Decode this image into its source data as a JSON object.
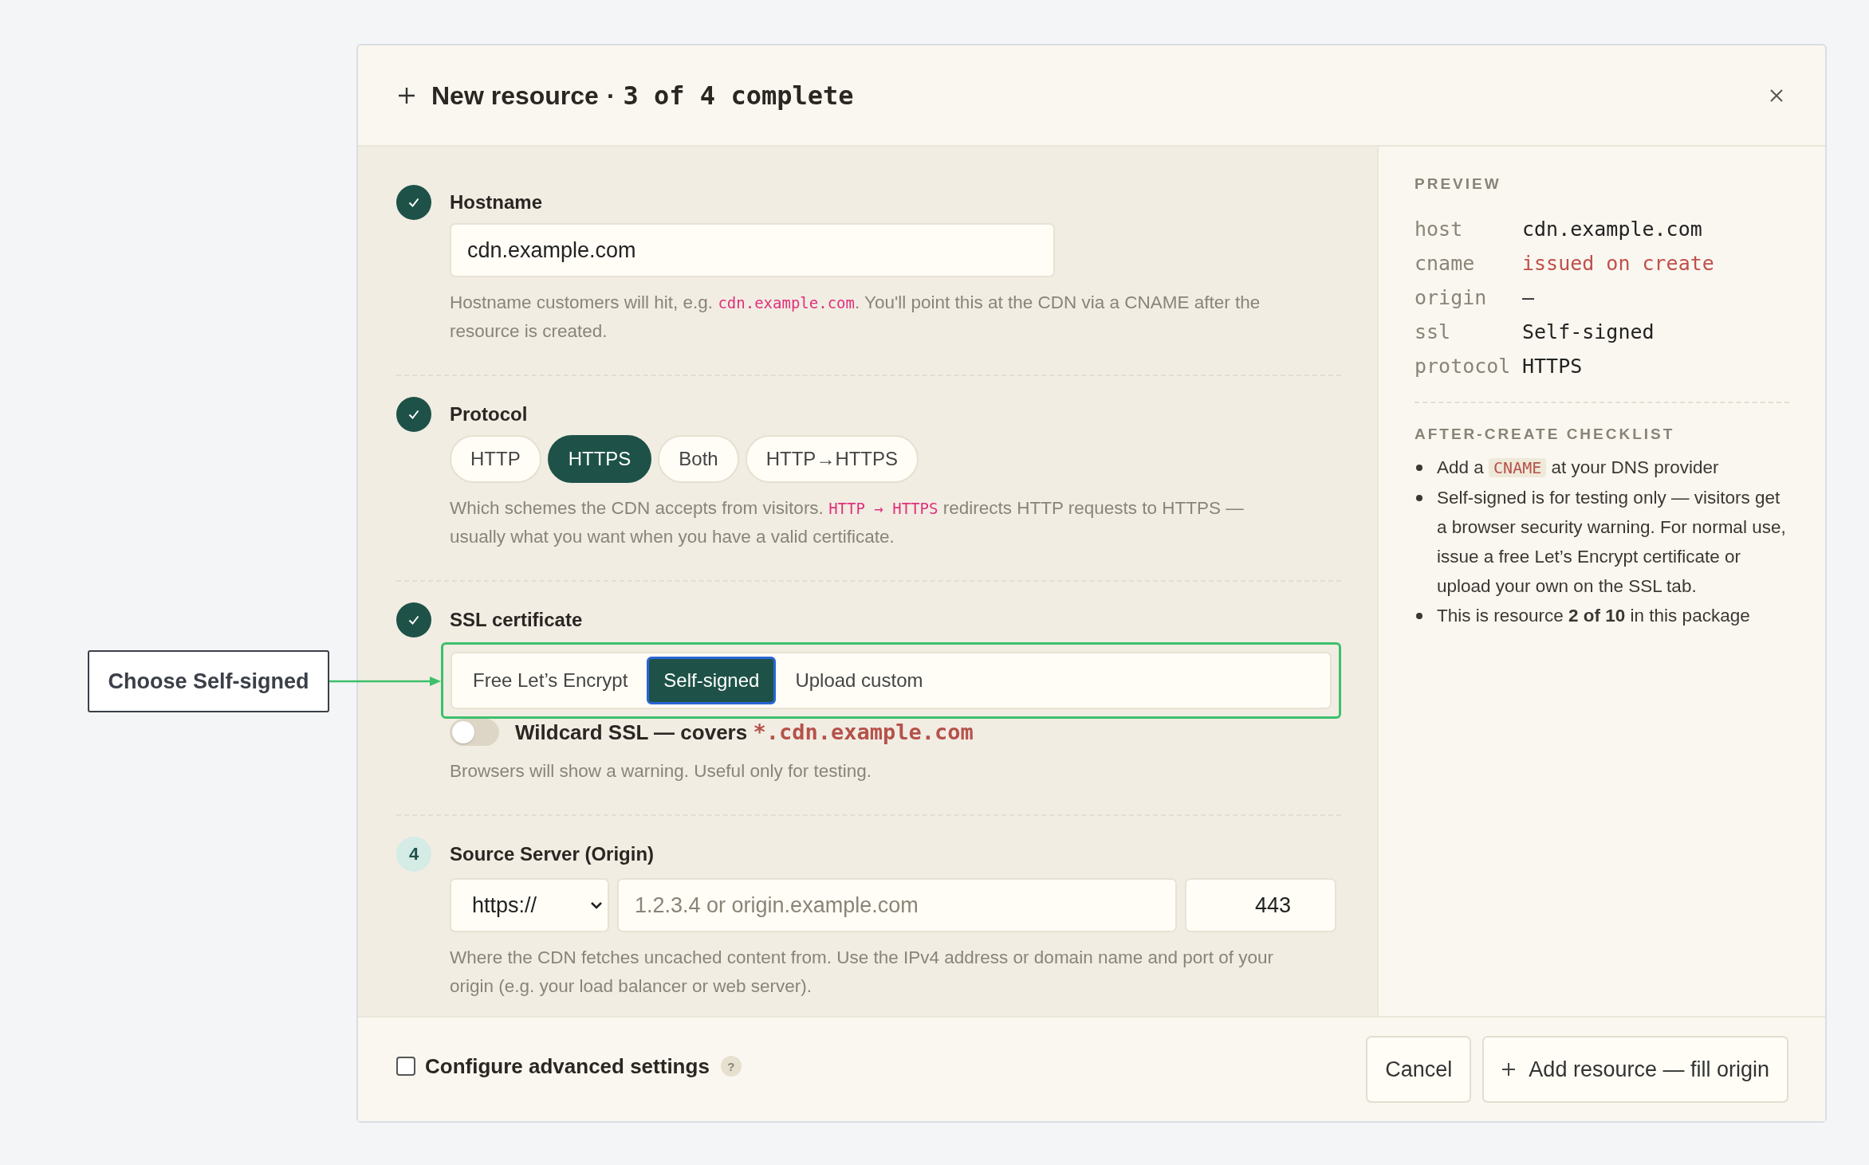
{
  "annotation": {
    "label": "Choose Self-signed"
  },
  "dialog": {
    "title": "New resource",
    "separator": "·",
    "progress": "3 of 4 complete"
  },
  "steps": [
    {
      "kind": "hostname",
      "completed": true,
      "label": "Hostname",
      "value": "cdn.example.com",
      "hint": [
        {
          "text": "Hostname customers will hit, e.g. ",
          "code": false
        },
        {
          "text": "cdn.example.com",
          "code": true
        },
        {
          "text": ". You'll point this at the CDN via a CNAME after the resource is created.",
          "code": false
        }
      ]
    },
    {
      "kind": "protocol",
      "completed": true,
      "label": "Protocol",
      "options": [
        {
          "label": "HTTP",
          "selected": false
        },
        {
          "label": "HTTPS",
          "selected": true
        },
        {
          "label": "Both",
          "selected": false
        },
        {
          "label": "HTTP→HTTPS",
          "selected": false
        }
      ],
      "hint": [
        {
          "text": "Which schemes the CDN accepts from visitors. ",
          "code": false
        },
        {
          "text": "HTTP → HTTPS",
          "code": true
        },
        {
          "text": " redirects HTTP requests to HTTPS — usually what you want when you have a valid certificate.",
          "code": false
        }
      ]
    },
    {
      "kind": "ssl",
      "completed": true,
      "label": "SSL certificate",
      "highlighted": true,
      "options": [
        {
          "label": "Free Let’s Encrypt",
          "selected": false
        },
        {
          "label": "Self-signed",
          "selected": true
        },
        {
          "label": "Upload custom",
          "selected": false
        }
      ],
      "toggle": {
        "on": false,
        "label": [
          {
            "text": "Wildcard SSL — covers ",
            "code": false
          },
          {
            "text": "*.cdn.example.com",
            "code": true
          }
        ]
      },
      "hint": [
        {
          "text": "Browsers will show a warning. Useful only for testing.",
          "code": false
        }
      ]
    },
    {
      "kind": "origin",
      "completed": false,
      "number": "4",
      "label": "Source Server (Origin)",
      "scheme": "https://",
      "host_placeholder": "1.2.3.4 or origin.example.com",
      "port": "443",
      "hint": [
        {
          "text": "Where the CDN fetches uncached content from. Use the IPv4 address or domain name and port of your origin (e.g. your load balancer or web server).",
          "code": false
        }
      ]
    }
  ],
  "preview": {
    "title": "PREVIEW",
    "rows": [
      {
        "key": "host",
        "value": "cdn.example.com",
        "pending": false
      },
      {
        "key": "cname",
        "value": "issued on create",
        "pending": true
      },
      {
        "key": "origin",
        "value": "—",
        "pending": false
      },
      {
        "key": "ssl",
        "value": "Self-signed",
        "pending": false
      },
      {
        "key": "protocol",
        "value": "HTTPS",
        "pending": false
      }
    ]
  },
  "checklist": {
    "title": "AFTER-CREATE CHECKLIST",
    "items": [
      {
        "parts": [
          {
            "text": "Add a ",
            "code": false
          },
          {
            "text": "CNAME",
            "code": true
          },
          {
            "text": " at your DNS provider",
            "code": false
          }
        ]
      },
      {
        "parts": [
          {
            "text": "Self-signed is for testing only — visitors get a browser security warning. For normal use, issue a free Let’s Encrypt certificate or upload your own on the SSL tab.",
            "code": false
          }
        ]
      },
      {
        "parts": [
          {
            "text": "This is resource **2 of 10** in this package",
            "code": false
          }
        ]
      }
    ]
  },
  "footer": {
    "advanced": {
      "checked": false,
      "label": "Configure advanced settings",
      "help": "?"
    },
    "buttons": [
      {
        "kind": "plain",
        "label": "Cancel"
      },
      {
        "kind": "add",
        "label": "Add resource — fill origin"
      }
    ]
  }
}
